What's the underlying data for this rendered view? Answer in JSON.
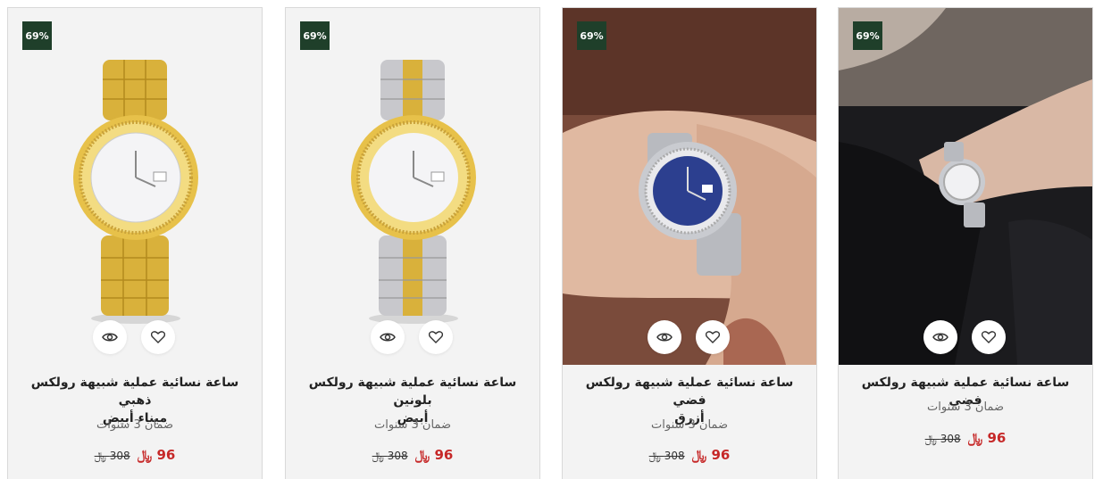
{
  "products": [
    {
      "badge": "69%",
      "title_line1": "ساعة نسائية عملية شبيهة رولكس ذهبي",
      "title_line2": "ميناء أبيض",
      "warranty": "ضمان 3 سنوات",
      "price": "96 ﷼",
      "old_price": "308 ﷼",
      "image": "gold-watch-white-dial"
    },
    {
      "badge": "69%",
      "title_line1": "ساعة نسائية عملية شبيهة رولكس بلونين",
      "title_line2": "أبيض",
      "warranty": "ضمان 3 سنوات",
      "price": "96 ﷼",
      "old_price": "308 ﷼",
      "image": "two-tone-watch-white-dial"
    },
    {
      "badge": "69%",
      "title_line1": "ساعة نسائية عملية شبيهة رولكس فضي",
      "title_line2": "أزرق",
      "warranty": "ضمان 3 سنوات",
      "price": "96 ﷼",
      "old_price": "308 ﷼",
      "image": "silver-watch-blue-dial-on-wrist"
    },
    {
      "badge": "69%",
      "title_line1": "ساعة نسائية عملية شبيهة رولكس فضي",
      "title_line2": "",
      "warranty": "ضمان 3 سنوات",
      "price": "96 ﷼",
      "old_price": "308 ﷼",
      "image": "silver-watch-on-wrist-dark-sleeve"
    }
  ],
  "icons": {
    "quick_view": "eye-icon",
    "wishlist": "heart-icon"
  },
  "colors": {
    "badge_bg": "#1f3f2a",
    "price": "#c62828",
    "card_bg": "#f3f3f3"
  }
}
